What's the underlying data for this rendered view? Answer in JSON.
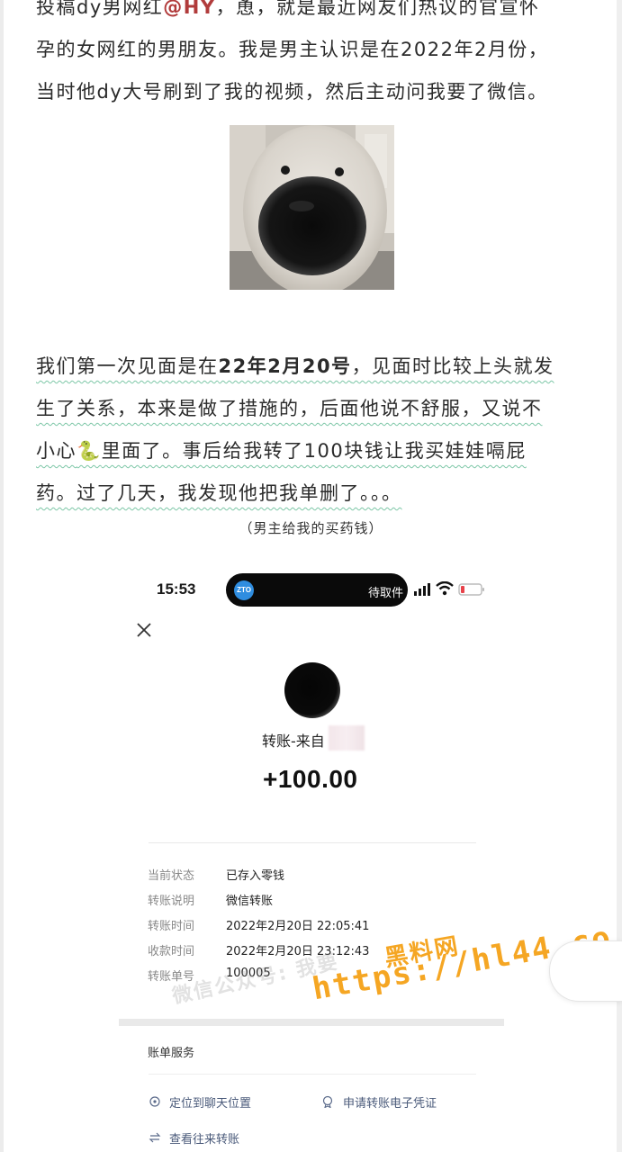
{
  "article": {
    "para1": {
      "l1": [
        "投稿dy男网红",
        "@HY",
        "，恿，就是最近网友们热议的官宣怀"
      ],
      "l2": "孕的女网红的男朋友。我是男主认识是在2022年2月份，",
      "l3": "当时他dy大号刷到了我的视频，然后主动问我要了微信。"
    },
    "image_alt_icon": "dog-nose-closeup-image",
    "para2": {
      "l1": [
        "我们第一次见面是在",
        "22年2月20号",
        "，见面时比较上头就发"
      ],
      "l2": "生了关系，本来是做了措施的，后面他说不舒服，又说不",
      "l3": [
        "小心",
        "🐍",
        "里面了。事后给我转了100块钱让我买娃娃嗝屁"
      ],
      "l4": "药。过了几天，我发现他把我单删了。。。"
    },
    "caption": "（男主给我的买药钱）"
  },
  "screenshot": {
    "time": "15:53",
    "island_logo": "ZTO",
    "island_text": "待取件",
    "transfer_from": "转账-来自",
    "amount": "+100.00",
    "details": [
      {
        "label": "当前状态",
        "value": "已存入零钱"
      },
      {
        "label": "转账说明",
        "value": "微信转账"
      },
      {
        "label": "转账时间",
        "value": "2022年2月20日 22:05:41"
      },
      {
        "label": "收款时间",
        "value": "2022年2月20日 23:12:43"
      },
      {
        "label": "转账单号",
        "value": "100005"
      }
    ],
    "bill_service": "账单服务",
    "actions": {
      "locate_chat": "定位到聊天位置",
      "apply_voucher": "申请转账电子凭证",
      "view_history": "查看往来转账"
    }
  },
  "watermarks": {
    "grey": "微信公众号: 我要",
    "brand_cn": "黑料网",
    "url": "https://hl44.co"
  },
  "colors": {
    "mention": "#b13b3b",
    "wavy_underline": "#7cc6a6",
    "watermark_orange": "#f5a623",
    "island_logo_blue": "#2f8de0"
  }
}
